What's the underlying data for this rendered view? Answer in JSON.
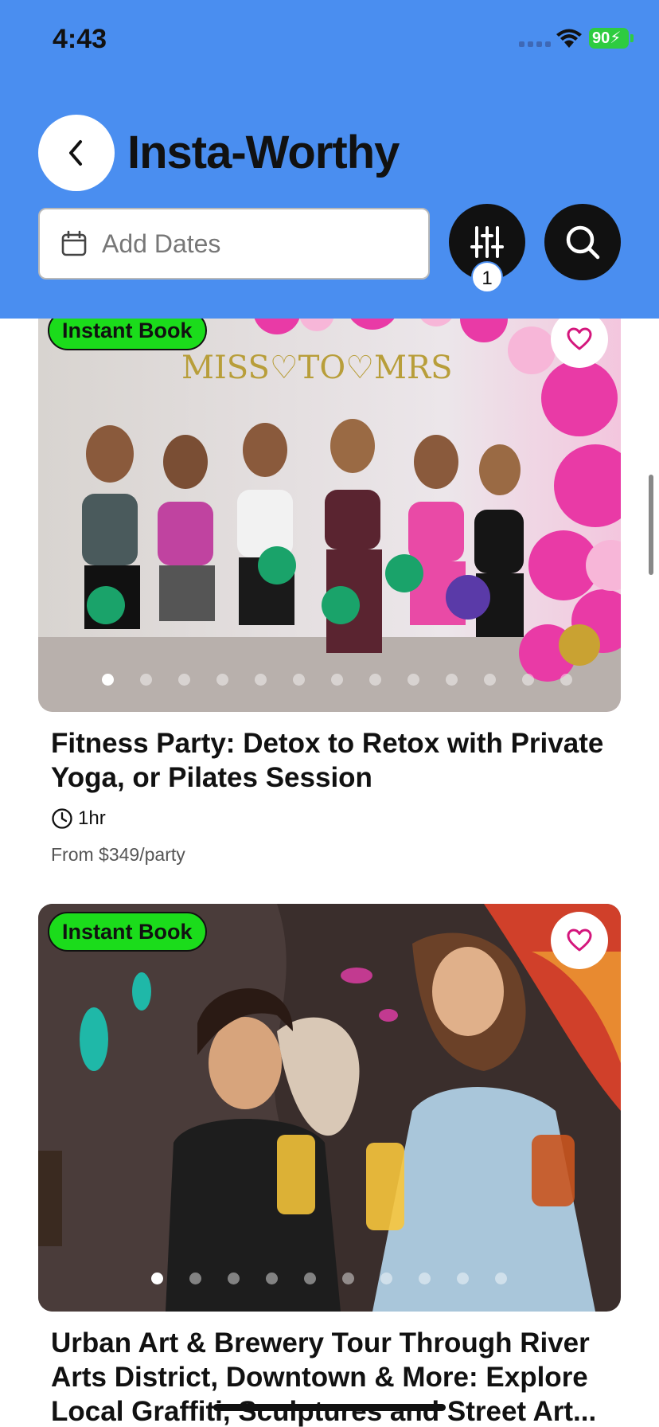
{
  "status_bar": {
    "time": "4:43",
    "battery": "90"
  },
  "header": {
    "title": "Insta-Worthy",
    "date_placeholder": "Add Dates",
    "filter_count": "1"
  },
  "colors": {
    "header": "#4a8ef0",
    "badge_green": "#1bdc1b",
    "heart": "#d4167c"
  },
  "listings": [
    {
      "badge": "Instant Book",
      "title": "Fitness Party: Detox to Retox with Private Yoga, or Pilates Session",
      "duration": "1hr",
      "price": "From $349/party",
      "image_dots": 13,
      "active_dot": 0
    },
    {
      "badge": "Instant Book",
      "title": "Urban Art & Brewery Tour Through River Arts District, Downtown & More: Explore Local Graffiti, Sculptures and Street Art...",
      "image_dots": 10,
      "active_dot": 0
    }
  ]
}
